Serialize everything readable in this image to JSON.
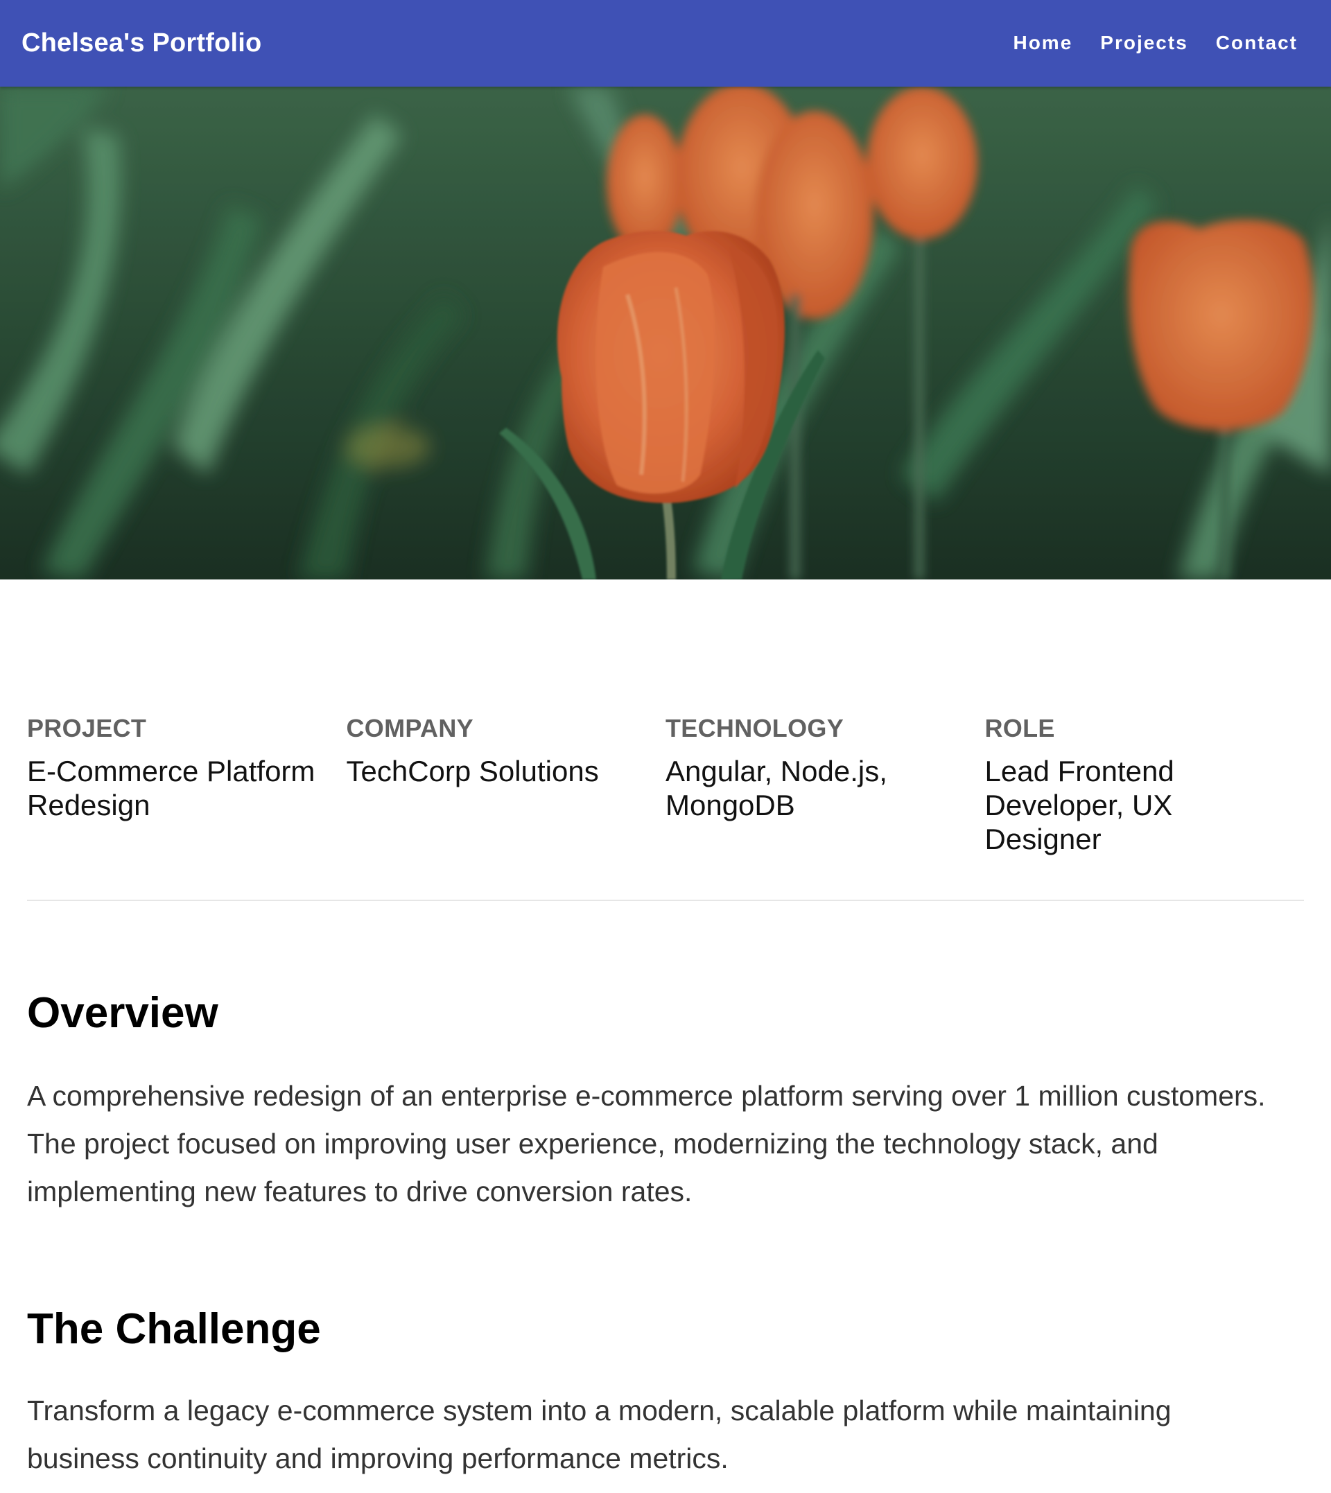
{
  "navbar": {
    "brand": "Chelsea's Portfolio",
    "links": [
      {
        "label": "Home"
      },
      {
        "label": "Projects"
      },
      {
        "label": "Contact"
      }
    ],
    "background": "#3f51b5"
  },
  "hero": {
    "image": "tulips-photo"
  },
  "meta": [
    {
      "label": "PROJECT",
      "value": "E-Commerce Platform Redesign"
    },
    {
      "label": "COMPANY",
      "value": "TechCorp Solutions"
    },
    {
      "label": "TECHNOLOGY",
      "value": "Angular, Node.js, MongoDB"
    },
    {
      "label": "ROLE",
      "value": "Lead Frontend Developer, UX Designer"
    }
  ],
  "overview": {
    "title": "Overview",
    "text": "A comprehensive redesign of an enterprise e-commerce platform serving over 1 million customers. The project focused on improving user experience, modernizing the technology stack, and implementing new features to drive conversion rates."
  },
  "challenge": {
    "title": "The Challenge",
    "text": "Transform a legacy e-commerce system into a modern, scalable platform while maintaining business continuity and improving performance metrics."
  }
}
